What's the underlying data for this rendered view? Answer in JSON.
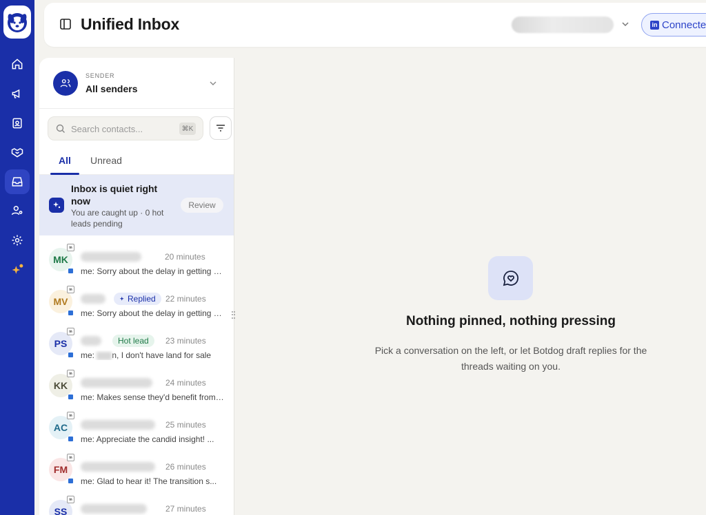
{
  "app": {
    "title": "Unified Inbox"
  },
  "header": {
    "connect_label": "Connecte",
    "connect_badge": "in"
  },
  "sender": {
    "label": "SENDER",
    "value": "All senders"
  },
  "search": {
    "placeholder": "Search contacts...",
    "shortcut": "⌘K"
  },
  "tabs": [
    {
      "label": "All",
      "active": true
    },
    {
      "label": "Unread",
      "active": false
    }
  ],
  "quiet_card": {
    "title": "Inbox is quiet right now",
    "subtitle": "You are caught up · 0 hot leads pending",
    "action": "Review"
  },
  "conversations": [
    {
      "initials": "MK",
      "time": "20 minutes",
      "tag": "",
      "preview": "me: Sorry about the delay in getting back to you",
      "color": "#1f7a48",
      "bg": "#e8f4ee"
    },
    {
      "initials": "MV",
      "time": "22 minutes",
      "tag": "Replied",
      "preview": "me: Sorry about the delay in getting back to you",
      "color": "#b07a1f",
      "bg": "#fbf1de"
    },
    {
      "initials": "PS",
      "time": "23 minutes",
      "tag": "Hot lead",
      "preview_prefix": "me:",
      "preview": "n, I don't have land for sale",
      "color": "#1a2fa8",
      "bg": "#e5e9f7"
    },
    {
      "initials": "KK",
      "time": "24 minutes",
      "tag": "",
      "preview": "me: Makes sense they'd benefit from this",
      "color": "#4d4d3a",
      "bg": "#efefe6"
    },
    {
      "initials": "AC",
      "time": "25 minutes",
      "tag": "",
      "preview": "me: Appreciate the candid insight! ...",
      "color": "#1f6a8a",
      "bg": "#e4f1f6"
    },
    {
      "initials": "FM",
      "time": "26 minutes",
      "tag": "",
      "preview": "me: Glad to hear it! The transition s...",
      "color": "#a02d2d",
      "bg": "#fae6e6"
    },
    {
      "initials": "SS",
      "time": "27 minutes",
      "tag": "",
      "preview": "",
      "color": "#1a2fa8",
      "bg": "#e5e9f7"
    }
  ],
  "empty_state": {
    "title": "Nothing pinned, nothing pressing",
    "body": "Pick a conversation on the left, or let Botdog draft replies for the threads waiting on you."
  },
  "nav": [
    "home-icon",
    "megaphone-icon",
    "contacts-icon",
    "handshake-icon",
    "inbox-icon",
    "user-settings-icon",
    "gear-icon",
    "sparkle-icon"
  ],
  "colors": {
    "brand": "#1a2fa8",
    "accent_bg": "#e5e9f7",
    "notification": "#f5b440"
  }
}
